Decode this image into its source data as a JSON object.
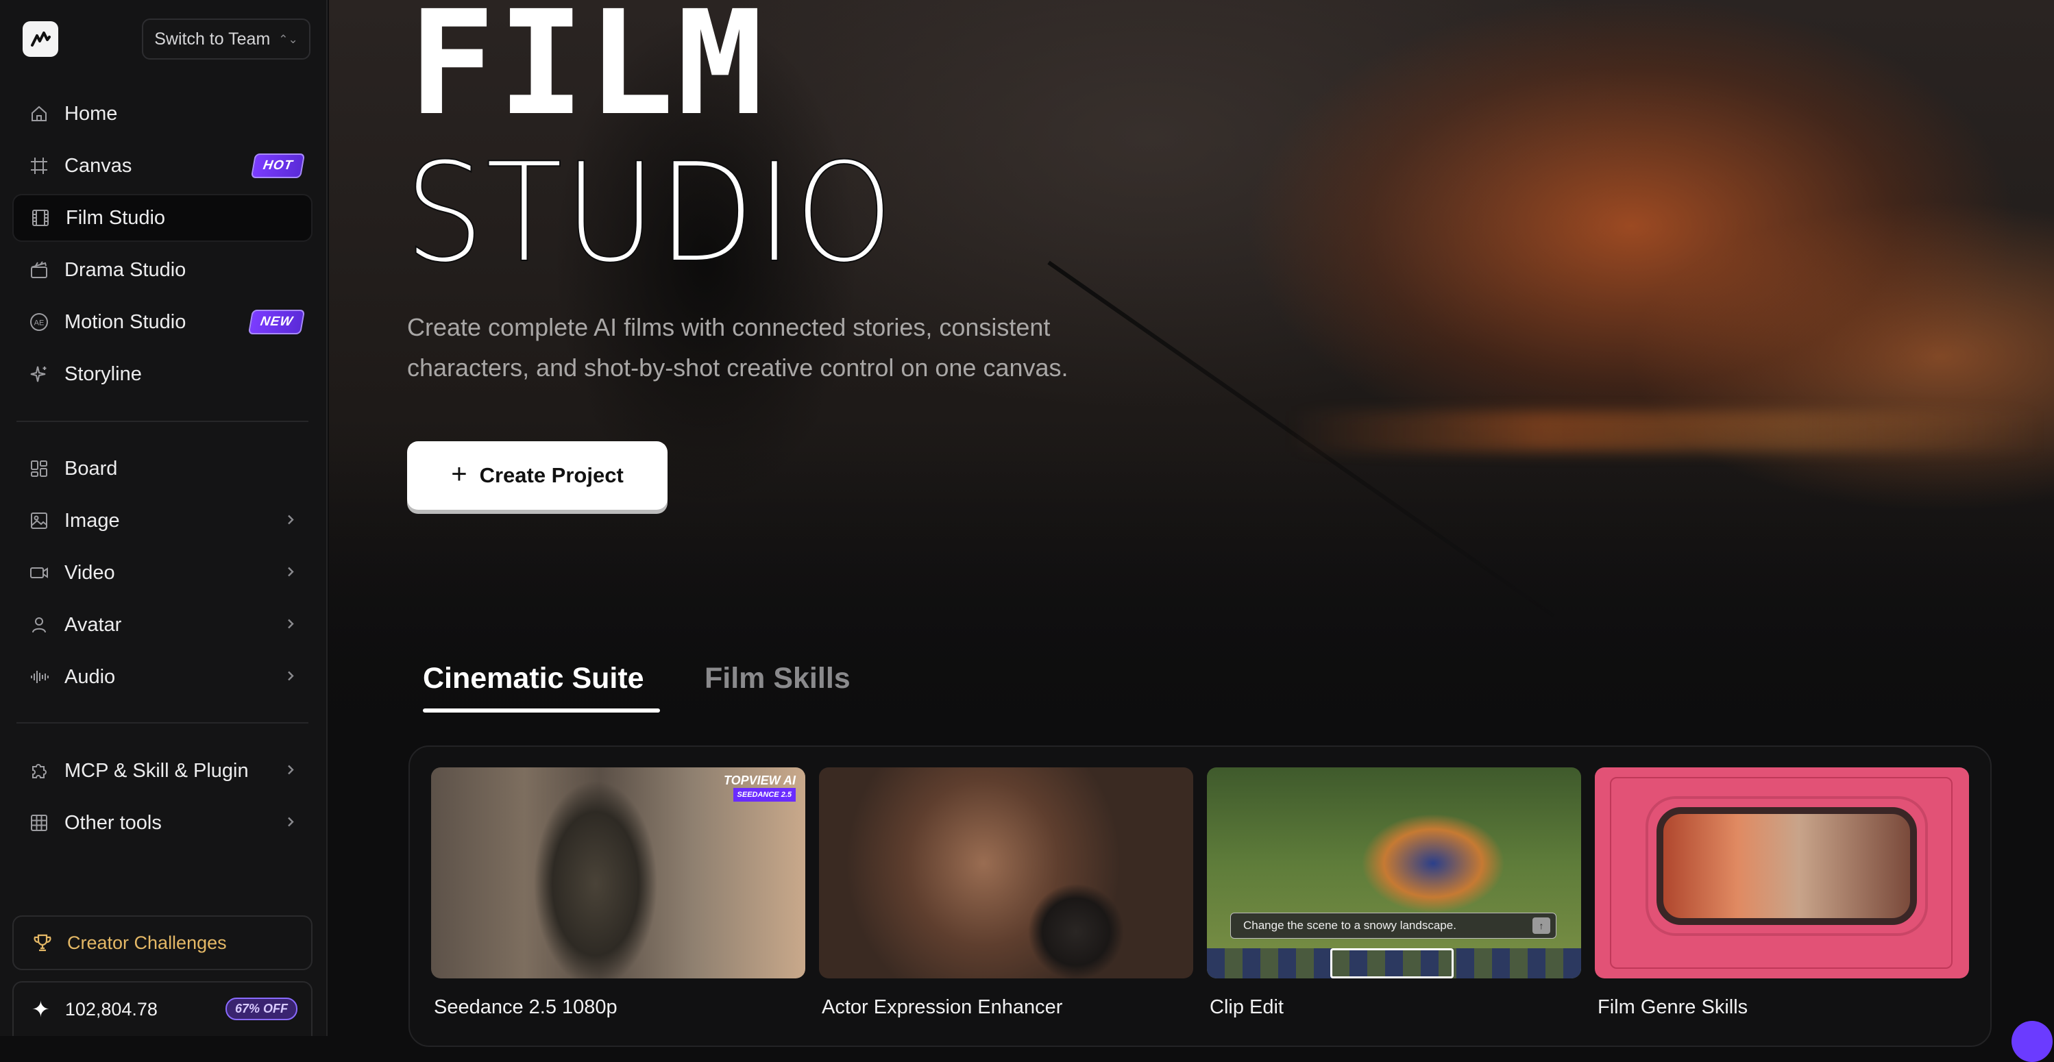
{
  "sidebar": {
    "team_switch": "Switch to Team",
    "nav_primary": [
      {
        "label": "Home",
        "icon": "home-icon"
      },
      {
        "label": "Canvas",
        "icon": "canvas-grid-icon",
        "badge": "HOT"
      },
      {
        "label": "Film Studio",
        "icon": "film-icon",
        "active": true
      },
      {
        "label": "Drama Studio",
        "icon": "clapperboard-icon"
      },
      {
        "label": "Motion Studio",
        "icon": "ae-icon",
        "badge": "NEW"
      },
      {
        "label": "Storyline",
        "icon": "sparkle-icon"
      }
    ],
    "nav_secondary": [
      {
        "label": "Board",
        "icon": "board-icon"
      },
      {
        "label": "Image",
        "icon": "image-icon"
      },
      {
        "label": "Video",
        "icon": "video-icon"
      },
      {
        "label": "Avatar",
        "icon": "avatar-icon"
      },
      {
        "label": "Audio",
        "icon": "audio-icon"
      }
    ],
    "nav_tertiary": [
      {
        "label": "MCP & Skill & Plugin",
        "icon": "puzzle-icon"
      },
      {
        "label": "Other tools",
        "icon": "grid-icon"
      }
    ],
    "challenges": "Creator Challenges",
    "credits": "102,804.78",
    "discount": "67% OFF"
  },
  "hero": {
    "title_line1": "FILM",
    "title_line2": "STUDIO",
    "subtitle_line1": "Create complete AI films with connected stories, consistent",
    "subtitle_line2": "characters, and shot-by-shot creative control on one canvas.",
    "cta": "Create Project"
  },
  "tabs": [
    {
      "label": "Cinematic Suite",
      "active": true
    },
    {
      "label": "Film Skills",
      "active": false
    }
  ],
  "cards": [
    {
      "label": "Seedance 2.5 1080p",
      "tag": "TOPVIEW AI",
      "tag_sub": "SEEDANCE 2.5"
    },
    {
      "label": "Actor Expression Enhancer"
    },
    {
      "label": "Clip Edit",
      "prompt": "Change the scene to a snowy landscape."
    },
    {
      "label": "Film Genre Skills"
    }
  ]
}
